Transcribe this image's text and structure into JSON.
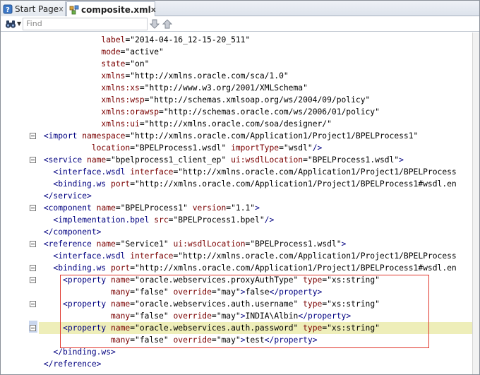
{
  "tabs": [
    {
      "label": "Start Page",
      "icon": "help-page-icon",
      "close": "x"
    },
    {
      "label": "composite.xml",
      "icon": "xml-file-icon",
      "close": "x"
    }
  ],
  "find": {
    "placeholder": "Find"
  },
  "code_lines": [
    {
      "indent": 6,
      "parts": [
        [
          "a",
          "label"
        ],
        [
          "p",
          "=\"2014-04-16_12-15-20_511\""
        ]
      ]
    },
    {
      "indent": 6,
      "parts": [
        [
          "a",
          "mode"
        ],
        [
          "p",
          "=\"active\""
        ]
      ]
    },
    {
      "indent": 6,
      "parts": [
        [
          "a",
          "state"
        ],
        [
          "p",
          "=\"on\""
        ]
      ]
    },
    {
      "indent": 6,
      "parts": [
        [
          "a",
          "xmlns"
        ],
        [
          "p",
          "=\"http://xmlns.oracle.com/sca/1.0\""
        ]
      ]
    },
    {
      "indent": 6,
      "parts": [
        [
          "a",
          "xmlns:xs"
        ],
        [
          "p",
          "=\"http://www.w3.org/2001/XMLSchema\""
        ]
      ]
    },
    {
      "indent": 6,
      "parts": [
        [
          "a",
          "xmlns:wsp"
        ],
        [
          "p",
          "=\"http://schemas.xmlsoap.org/ws/2004/09/policy\""
        ]
      ]
    },
    {
      "indent": 6,
      "parts": [
        [
          "a",
          "xmlns:orawsp"
        ],
        [
          "p",
          "=\"http://schemas.oracle.com/ws/2006/01/policy\""
        ]
      ]
    },
    {
      "indent": 6,
      "parts": [
        [
          "a",
          "xmlns:ui"
        ],
        [
          "p",
          "=\"http://xmlns.oracle.com/soa/designer/\""
        ]
      ]
    },
    {
      "indent": 0,
      "fold": true,
      "parts": [
        [
          "t",
          "<import "
        ],
        [
          "a",
          "namespace"
        ],
        [
          "p",
          "=\"http://xmlns.oracle.com/Application1/Project1/BPELProcess1\""
        ]
      ]
    },
    {
      "indent": 5,
      "parts": [
        [
          "a",
          "location"
        ],
        [
          "p",
          "=\"BPELProcess1.wsdl\" "
        ],
        [
          "a",
          "importType"
        ],
        [
          "p",
          "=\"wsdl\""
        ],
        [
          "t",
          "/>"
        ]
      ]
    },
    {
      "indent": 0,
      "fold": true,
      "parts": [
        [
          "t",
          "<service "
        ],
        [
          "a",
          "name"
        ],
        [
          "p",
          "=\"bpelprocess1_client_ep\" "
        ],
        [
          "a",
          "ui:wsdlLocation"
        ],
        [
          "p",
          "=\"BPELProcess1.wsdl\""
        ],
        [
          "t",
          ">"
        ]
      ]
    },
    {
      "indent": 1,
      "parts": [
        [
          "t",
          "<interface.wsdl "
        ],
        [
          "a",
          "interface"
        ],
        [
          "p",
          "=\"http://xmlns.oracle.com/Application1/Project1/BPELProcess"
        ]
      ]
    },
    {
      "indent": 1,
      "parts": [
        [
          "t",
          "<binding.ws "
        ],
        [
          "a",
          "port"
        ],
        [
          "p",
          "=\"http://xmlns.oracle.com/Application1/Project1/BPELProcess1#wsdl.en"
        ]
      ]
    },
    {
      "indent": 0,
      "parts": [
        [
          "t",
          "</service>"
        ]
      ]
    },
    {
      "indent": 0,
      "fold": true,
      "parts": [
        [
          "t",
          "<component "
        ],
        [
          "a",
          "name"
        ],
        [
          "p",
          "=\"BPELProcess1\" "
        ],
        [
          "a",
          "version"
        ],
        [
          "p",
          "=\"1.1\""
        ],
        [
          "t",
          ">"
        ]
      ]
    },
    {
      "indent": 1,
      "parts": [
        [
          "t",
          "<implementation.bpel "
        ],
        [
          "a",
          "src"
        ],
        [
          "p",
          "=\"BPELProcess1.bpel\""
        ],
        [
          "t",
          "/>"
        ]
      ]
    },
    {
      "indent": 0,
      "parts": [
        [
          "t",
          "</component>"
        ]
      ]
    },
    {
      "indent": 0,
      "fold": true,
      "parts": [
        [
          "t",
          "<reference "
        ],
        [
          "a",
          "name"
        ],
        [
          "p",
          "=\"Service1\" "
        ],
        [
          "a",
          "ui:wsdlLocation"
        ],
        [
          "p",
          "=\"BPELProcess1.wsdl\""
        ],
        [
          "t",
          ">"
        ]
      ]
    },
    {
      "indent": 1,
      "parts": [
        [
          "t",
          "<interface.wsdl "
        ],
        [
          "a",
          "interface"
        ],
        [
          "p",
          "=\"http://xmlns.oracle.com/Application1/Project1/BPELProcess"
        ]
      ]
    },
    {
      "indent": 1,
      "fold": true,
      "parts": [
        [
          "t",
          "<binding.ws "
        ],
        [
          "a",
          "port"
        ],
        [
          "p",
          "=\"http://xmlns.oracle.com/Application1/Project1/BPELProcess1#wsdl.en"
        ]
      ]
    },
    {
      "indent": 2,
      "fold": true,
      "parts": [
        [
          "t",
          "<property "
        ],
        [
          "a",
          "name"
        ],
        [
          "p",
          "=\"oracle.webservices.proxyAuthType\" "
        ],
        [
          "a",
          "type"
        ],
        [
          "p",
          "=\"xs:string\""
        ]
      ]
    },
    {
      "indent": 7,
      "parts": [
        [
          "a",
          "many"
        ],
        [
          "p",
          "=\"false\" "
        ],
        [
          "a",
          "override"
        ],
        [
          "p",
          "=\"may\""
        ],
        [
          "t",
          ">"
        ],
        [
          "x",
          "false"
        ],
        [
          "t",
          "</property>"
        ]
      ]
    },
    {
      "indent": 2,
      "fold": true,
      "parts": [
        [
          "t",
          "<property "
        ],
        [
          "a",
          "name"
        ],
        [
          "p",
          "=\"oracle.webservices.auth.username\" "
        ],
        [
          "a",
          "type"
        ],
        [
          "p",
          "=\"xs:string\""
        ]
      ]
    },
    {
      "indent": 7,
      "parts": [
        [
          "a",
          "many"
        ],
        [
          "p",
          "=\"false\" "
        ],
        [
          "a",
          "override"
        ],
        [
          "p",
          "=\"may\""
        ],
        [
          "t",
          ">"
        ],
        [
          "x",
          "INDIA\\Albin"
        ],
        [
          "t",
          "</property>"
        ]
      ]
    },
    {
      "indent": 2,
      "fold": true,
      "highlight": true,
      "parts": [
        [
          "t",
          "<property "
        ],
        [
          "a",
          "name"
        ],
        [
          "p",
          "=\"oracle.webservices.auth.password\" "
        ],
        [
          "a",
          "type"
        ],
        [
          "p",
          "=\"xs:string\""
        ]
      ]
    },
    {
      "indent": 7,
      "parts": [
        [
          "a",
          "many"
        ],
        [
          "p",
          "=\"false\" "
        ],
        [
          "a",
          "override"
        ],
        [
          "p",
          "=\"may\""
        ],
        [
          "t",
          ">"
        ],
        [
          "x",
          "test"
        ],
        [
          "t",
          "</property>"
        ]
      ]
    },
    {
      "indent": 1,
      "parts": [
        [
          "t",
          "</binding.ws>"
        ]
      ]
    },
    {
      "indent": 0,
      "parts": [
        [
          "t",
          "</reference>"
        ]
      ]
    }
  ],
  "colors": {
    "tag": "#000080",
    "attribute": "#7a0000",
    "value": "#000000",
    "highlight": "#eeeeb9",
    "annotation_box": "#e0352b"
  }
}
